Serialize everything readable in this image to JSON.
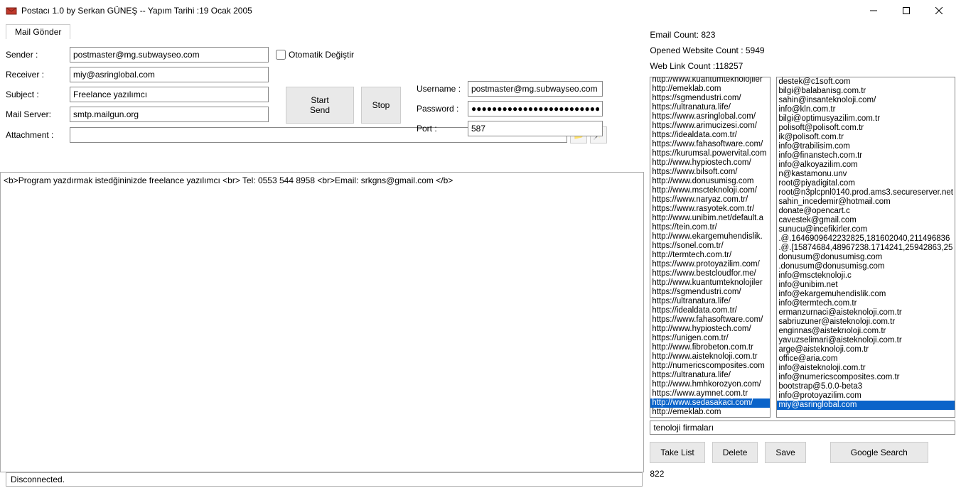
{
  "window": {
    "title": "Postacı 1.0 by Serkan GÜNEŞ -- Yapım Tarihi :19 Ocak 2005"
  },
  "tab": {
    "label": "Mail Gönder"
  },
  "labels": {
    "sender": "Sender :",
    "receiver": "Receiver :",
    "subject": "Subject :",
    "mailserver": "Mail Server:",
    "attachment": "Attachment :",
    "auto_change": "Otomatik Değiştir",
    "username": "Username :",
    "password": "Password :",
    "port": "Port :"
  },
  "fields": {
    "sender": "postmaster@mg.subwayseo.com",
    "receiver": "miy@asringlobal.com",
    "subject": "Freelance yazılımcı",
    "mailserver": "smtp.mailgun.org",
    "attachment": "",
    "username": "postmaster@mg.subwayseo.com",
    "password": "●●●●●●●●●●●●●●●●●●●●●●●●●●",
    "port": "587",
    "auto_change_checked": false
  },
  "buttons": {
    "start": "Start Send",
    "stop": "Stop",
    "take_list": "Take List",
    "delete": "Delete",
    "save": "Save",
    "google": "Google Search"
  },
  "body_text": "<b>Program yazdırmak istedğininizde freelance yazılımcı <br> Tel: 0553 544 8958 <br>Email: srkgns@gmail.com </b>",
  "stats": {
    "email_count": "Email Count: 823",
    "opened_count": "Opened Website Count : 5949",
    "weblink_count": "Web Link Count :118257"
  },
  "url_list": [
    "http://www.kuantumteknolojiler",
    "http://emeklab.com",
    "https://sgmendustri.com/",
    "https://ultranatura.life/",
    "https://www.asringlobal.com/",
    "https://www.arimucizesi.com/",
    "https://idealdata.com.tr/",
    "https://www.fahasoftware.com/",
    "https://kurumsal.powervital.com",
    "http://www.hypiostech.com/",
    "https://www.bilsoft.com/",
    "http://www.donusumisg.com",
    "http://www.mscteknoloji.com/",
    "https://www.naryaz.com.tr/",
    "https://www.rasyotek.com.tr/",
    "http://www.unibim.net/default.a",
    "https://tein.com.tr/",
    "http://www.ekargemuhendislik.",
    "https://sonel.com.tr/",
    "http://termtech.com.tr/",
    "https://www.protoyazilim.com/",
    "https://www.bestcloudfor.me/",
    "http://www.kuantumteknolojiler",
    "https://sgmendustri.com/",
    "https://ultranatura.life/",
    "https://idealdata.com.tr/",
    "https://www.fahasoftware.com/",
    "http://www.hypiostech.com/",
    "https://unigen.com.tr/",
    "http://www.fibrobeton.com.tr",
    "http://www.aisteknoloji.com.tr",
    "http://numericscomposites.com",
    "https://ultranatura.life/",
    "http://www.hmhkorozyon.com/",
    "https://www.aymnet.com.tr",
    "http://www.sedasakaci.com/",
    "http://emeklab.com"
  ],
  "url_selected_index": 35,
  "email_list": [
    "destek@c1soft.com",
    "bilgi@balabanisg.com.tr",
    "sahin@insanteknoloji.com/",
    "info@kln.com.tr",
    "bilgi@optimusyazilim.com.tr",
    "polisoft@polisoft.com.tr",
    "ik@polisoft.com.tr",
    "info@trabilisim.com",
    "info@finanstech.com.tr",
    "info@alkoyazilim.com",
    "n@kastamonu.unv",
    "root@piyadigital.com",
    "root@n3plcpnl0140.prod.ams3.secureserver.net",
    "sahin_incedemir@hotmail.com",
    "donate@opencart.c",
    "cavestek@gmail.com",
    "sunucu@incefikirler.com",
    ".@.1646909642232825,181602040,211496836",
    ".@.[15874684,48967238.1714241,25942863,25",
    "donusum@donusumisg.com",
    ".donusum@donusumisg.com",
    "info@mscteknoloji.c",
    "info@unibim.net",
    "info@ekargemuhendislik.com",
    "info@termtech.com.tr",
    "ermanzurnaci@aisteknoloji.com.tr",
    "sabriuzuner@aisteknoloji.com.tr",
    "enginnas@aistekrıoloji.com.tr",
    "yavuzselimari@aisteknoloji.com.tr",
    "arge@aisteknoloji.com.tr",
    "office@aria.com",
    "info@aisteknoloji.com.tr",
    "info@numericscomposites.com.tr",
    "bootstrap@5.0.0-beta3",
    "info@protoyazilim.com",
    "miy@asringlobal.com"
  ],
  "email_selected_index": 35,
  "search_value": "tenoloji firmaları",
  "bottom_count": "822",
  "status": "Disconnected."
}
